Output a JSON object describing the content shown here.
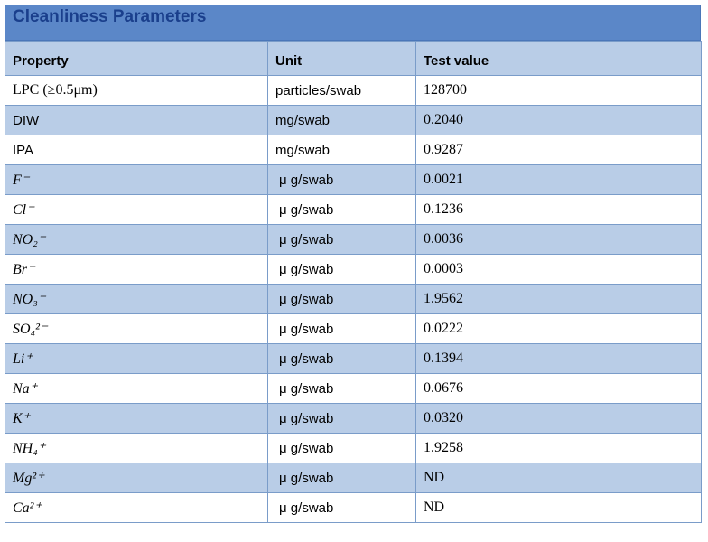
{
  "title": "Cleanliness Parameters",
  "headers": {
    "property": "Property",
    "unit": "Unit",
    "value": "Test value"
  },
  "rows": [
    {
      "property": "LPC (≥0.5μm)",
      "unit": "particles/swab",
      "value": "128700"
    },
    {
      "property": "DIW",
      "unit": "mg/swab",
      "value": "0.2040"
    },
    {
      "property": "IPA",
      "unit": "mg/swab",
      "value": "0.9287"
    },
    {
      "property": "F⁻",
      "unit": "μ g/swab",
      "value": "0.0021"
    },
    {
      "property": "Cl⁻",
      "unit": "μ g/swab",
      "value": "0.1236"
    },
    {
      "property": "NO₂⁻",
      "unit": "μ g/swab",
      "value": "0.0036"
    },
    {
      "property": "Br⁻",
      "unit": "μ g/swab",
      "value": "0.0003"
    },
    {
      "property": "NO₃⁻",
      "unit": "μ g/swab",
      "value": "1.9562"
    },
    {
      "property": "SO₄²⁻",
      "unit": "μ g/swab",
      "value": "0.0222"
    },
    {
      "property": "Li⁺",
      "unit": "μ g/swab",
      "value": "0.1394"
    },
    {
      "property": "Na⁺",
      "unit": "μ g/swab",
      "value": "0.0676"
    },
    {
      "property": "K⁺",
      "unit": "μ g/swab",
      "value": "0.0320"
    },
    {
      "property": "NH₄⁺",
      "unit": "μ g/swab",
      "value": "1.9258"
    },
    {
      "property": "Mg²⁺",
      "unit": "μ g/swab",
      "value": "ND"
    },
    {
      "property": "Ca²⁺",
      "unit": "μ g/swab",
      "value": "ND"
    }
  ]
}
